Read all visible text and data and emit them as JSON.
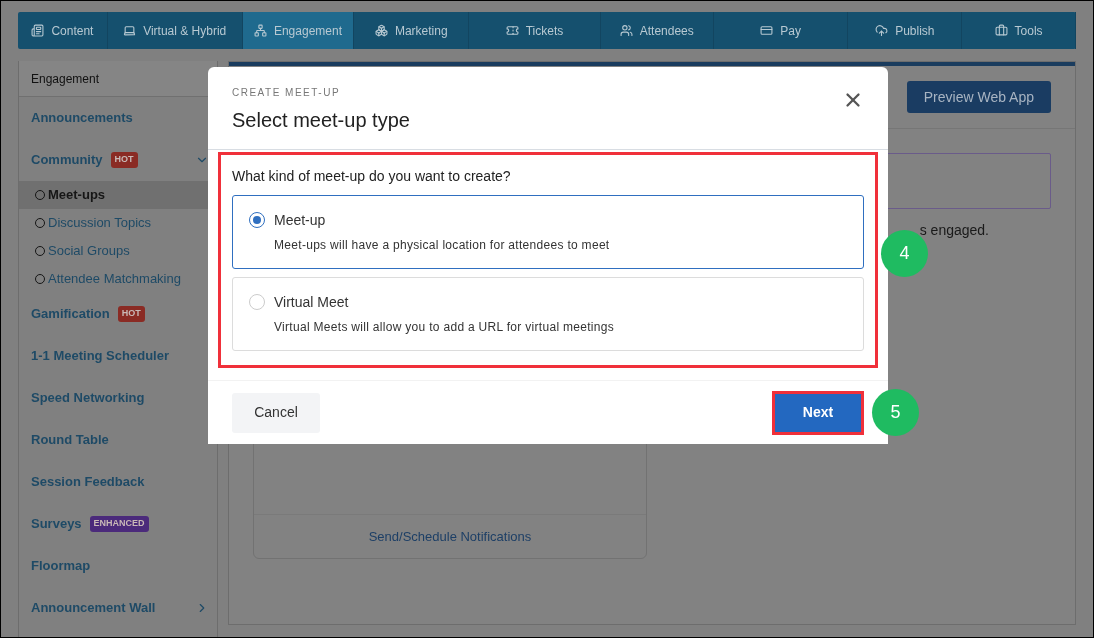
{
  "nav_tabs": [
    {
      "label": "Content",
      "selected": false
    },
    {
      "label": "Virtual & Hybrid",
      "selected": false
    },
    {
      "label": "Engagement",
      "selected": true
    },
    {
      "label": "Marketing",
      "selected": false
    },
    {
      "label": "Tickets",
      "selected": false
    },
    {
      "label": "Attendees",
      "selected": false
    },
    {
      "label": "Pay",
      "selected": false
    },
    {
      "label": "Publish",
      "selected": false
    },
    {
      "label": "Tools",
      "selected": false
    }
  ],
  "sidebar": {
    "title": "Engagement",
    "items": [
      {
        "label": "Announcements"
      },
      {
        "label": "Community",
        "badge": {
          "text": "HOT",
          "color": "#8a2b24"
        },
        "expanded": true,
        "children": [
          {
            "label": "Meet-ups",
            "selected": true
          },
          {
            "label": "Discussion Topics",
            "selected": false
          },
          {
            "label": "Social Groups",
            "selected": false
          },
          {
            "label": "Attendee Matchmaking",
            "selected": false
          }
        ]
      },
      {
        "label": "Gamification",
        "badge": {
          "text": "HOT",
          "color": "#8a2b24"
        }
      },
      {
        "label": "1-1 Meeting Scheduler"
      },
      {
        "label": "Speed Networking"
      },
      {
        "label": "Round Table"
      },
      {
        "label": "Session Feedback"
      },
      {
        "label": "Surveys",
        "badge": {
          "text": "ENHANCED",
          "color": "#4b2a7b"
        }
      },
      {
        "label": "Floormap"
      },
      {
        "label": "Announcement Wall",
        "expanded": false
      }
    ]
  },
  "main": {
    "preview_button": "Preview Web App",
    "partial_text": "s engaged.",
    "card_link": "Send/Schedule Notifications"
  },
  "modal": {
    "eyebrow": "CREATE MEET-UP",
    "title": "Select meet-up type",
    "question": "What kind of meet-up do you want to create?",
    "options": [
      {
        "title": "Meet-up",
        "description": "Meet-ups will have a physical location for attendees to meet",
        "selected": true
      },
      {
        "title": "Virtual Meet",
        "description": "Virtual Meets will allow you to add a URL for virtual meetings",
        "selected": false
      }
    ],
    "cancel": "Cancel",
    "next": "Next"
  },
  "step_markers": [
    "4",
    "5"
  ]
}
